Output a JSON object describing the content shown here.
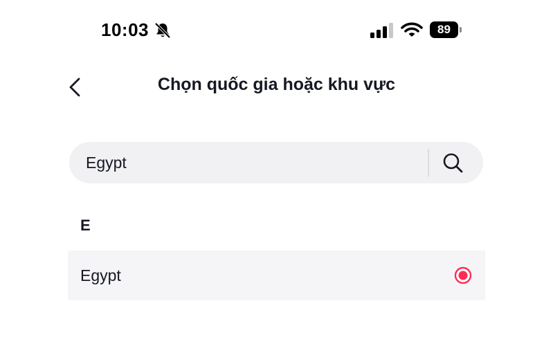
{
  "status_bar": {
    "time": "10:03",
    "battery": "89",
    "icons": [
      "bell-slash-icon",
      "cellular-signal-icon",
      "wifi-icon",
      "battery-icon"
    ]
  },
  "header": {
    "back_icon": "chevron-left-icon",
    "title": "Chọn quốc gia hoặc khu vực"
  },
  "search": {
    "value": "Egypt",
    "icon": "search-icon"
  },
  "list": {
    "section": "E",
    "items": [
      {
        "label": "Egypt",
        "selected": true
      }
    ]
  },
  "colors": {
    "accent": "#fe2c55",
    "search_bg": "#f1f1f3",
    "row_bg": "#f5f5f7",
    "text": "#161823"
  }
}
